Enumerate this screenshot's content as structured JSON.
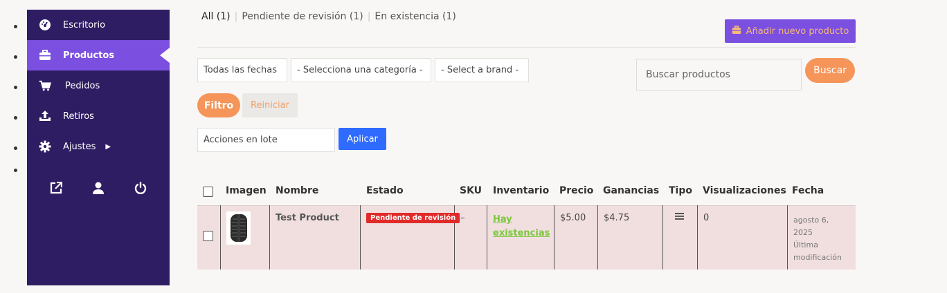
{
  "sidebar": {
    "items": [
      {
        "label": "Escritorio",
        "icon": "dashboard-icon"
      },
      {
        "label": "Productos",
        "icon": "briefcase-icon",
        "active": true
      },
      {
        "label": "Pedidos",
        "icon": "cart-icon"
      },
      {
        "label": "Retiros",
        "icon": "upload-icon"
      },
      {
        "label": "Ajustes",
        "icon": "gear-icon"
      }
    ],
    "footer_icons": [
      "external-link-icon",
      "user-icon",
      "power-icon"
    ]
  },
  "status_tabs": [
    {
      "label": "All (1)"
    },
    {
      "label": "Pendiente de revisión (1)"
    },
    {
      "label": "En existencia (1)"
    }
  ],
  "add_product_label": "Añadir nuevo producto",
  "filters": {
    "date": "Todas las fechas",
    "category": "- Selecciona una categoría -",
    "brand": "- Select a brand -",
    "filter_label": "Filtro",
    "reset_label": "Reiniciar"
  },
  "search": {
    "placeholder": "Buscar productos",
    "button_label": "Buscar"
  },
  "bulk": {
    "label": "Acciones en lote",
    "apply_label": "Aplicar"
  },
  "table": {
    "headers": [
      "Imagen",
      "Nombre",
      "Estado",
      "SKU",
      "Inventario",
      "Precio",
      "Ganancias",
      "Tipo",
      "Visualizaciones",
      "Fecha"
    ],
    "rows": [
      {
        "name": "Test Product",
        "status": "Pendiente de revisión",
        "sku": "–",
        "inventory_line1": "Hay",
        "inventory_line2": "existencias",
        "price": "$5.00",
        "earnings": "$4.75",
        "type_icon": "hamburger-icon",
        "views": "0",
        "date_line1": "agosto 6,",
        "date_line2": "2025",
        "date_line3": "Última",
        "date_line4": "modificación"
      }
    ]
  },
  "colors": {
    "sidebar": "#2f1d63",
    "accent_purple": "#7b4fe0",
    "accent_orange": "#f5955a",
    "apply_blue": "#2f6bff",
    "badge_red": "#e12a2a",
    "stock_green": "#7bc83b",
    "row_bg": "#f1dfdf"
  }
}
